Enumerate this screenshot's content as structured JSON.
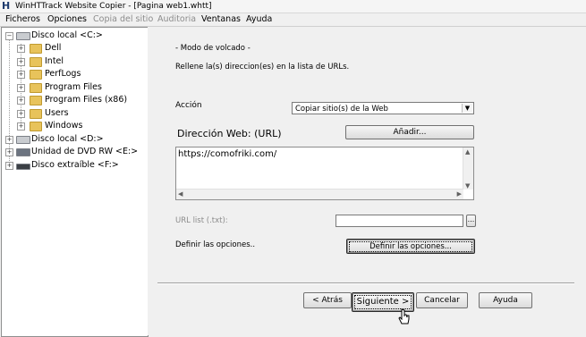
{
  "window": {
    "title": "WinHTTrack Website Copier - [Pagina web1.whtt]",
    "app_icon_glyph": "H"
  },
  "menu": [
    {
      "label": "Ficheros",
      "enabled": true
    },
    {
      "label": "Opciones",
      "enabled": true
    },
    {
      "label": "Copia del sitio",
      "enabled": false
    },
    {
      "label": "Auditoria",
      "enabled": false
    },
    {
      "label": "Ventanas",
      "enabled": true
    },
    {
      "label": "Ayuda",
      "enabled": true
    }
  ],
  "tree": {
    "items": [
      {
        "label": "Disco local <C:>",
        "icon": "hard-drive-icon",
        "expanded": true
      },
      {
        "label": "Dell",
        "icon": "folder-icon"
      },
      {
        "label": "Intel",
        "icon": "folder-icon"
      },
      {
        "label": "PerfLogs",
        "icon": "folder-icon"
      },
      {
        "label": "Program Files",
        "icon": "folder-icon"
      },
      {
        "label": "Program Files (x86)",
        "icon": "folder-icon"
      },
      {
        "label": "Users",
        "icon": "folder-icon"
      },
      {
        "label": "Windows",
        "icon": "folder-icon"
      },
      {
        "label": "Disco local <D:>",
        "icon": "hard-drive-icon"
      },
      {
        "label": "Unidad de DVD RW <E:>",
        "icon": "dvd-drive-icon"
      },
      {
        "label": "Disco extraíble <F:>",
        "icon": "removable-drive-icon"
      }
    ]
  },
  "main": {
    "mode_title": "- Modo de volcado -",
    "instructions": "Rellene la(s) direccion(es) en la lista de URLs.",
    "action_label": "Acción",
    "action_value": "Copiar sitio(s) de la Web",
    "web_address_label": "Dirección Web: (URL)",
    "add_button": "Añadir...",
    "urls_value": "https://comofriki.com/",
    "url_list_label": "URL list (.txt):",
    "url_list_value": "",
    "browse_button": "...",
    "define_options_label": "Definir las opciones..",
    "define_options_button": "Definir las opciones..."
  },
  "footer": {
    "back_button": "< Atrás",
    "next_button": "Siguiente >",
    "cancel_button": "Cancelar",
    "help_button": "Ayuda"
  },
  "colors": {
    "folder": "#e8c35b",
    "background": "#f0f0f0"
  }
}
